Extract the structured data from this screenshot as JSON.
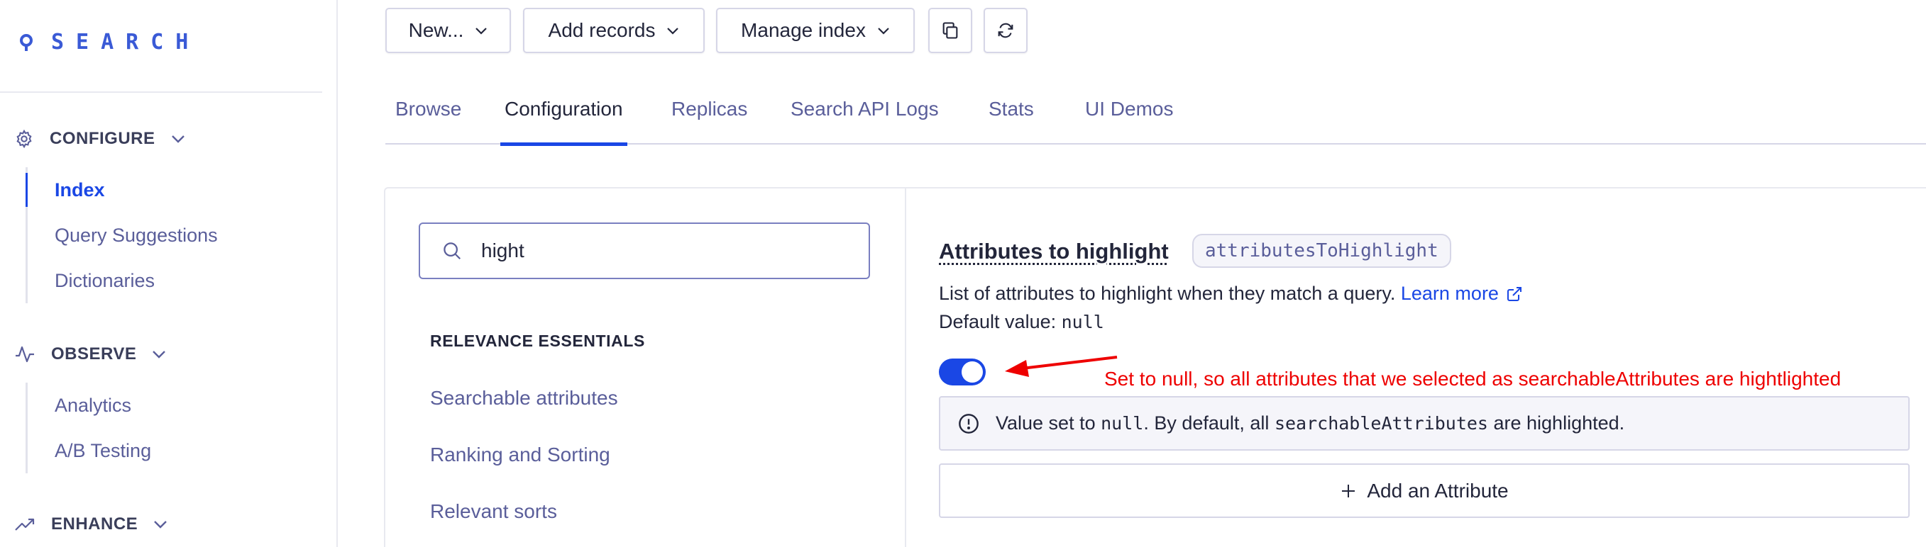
{
  "app": {
    "logo_text": "SEARCH"
  },
  "sidebar": {
    "sections": [
      {
        "label": "CONFIGURE",
        "icon": "gear-icon",
        "items": [
          {
            "label": "Index",
            "active": true
          },
          {
            "label": "Query Suggestions",
            "active": false
          },
          {
            "label": "Dictionaries",
            "active": false
          }
        ]
      },
      {
        "label": "OBSERVE",
        "icon": "activity-icon",
        "items": [
          {
            "label": "Analytics",
            "active": false
          },
          {
            "label": "A/B Testing",
            "active": false
          }
        ]
      },
      {
        "label": "ENHANCE",
        "icon": "trending-icon",
        "items": []
      }
    ]
  },
  "toolbar": {
    "new_label": "New...",
    "add_records_label": "Add records",
    "manage_index_label": "Manage index"
  },
  "tabs": [
    {
      "label": "Browse",
      "active": false
    },
    {
      "label": "Configuration",
      "active": true
    },
    {
      "label": "Replicas",
      "active": false
    },
    {
      "label": "Search API Logs",
      "active": false
    },
    {
      "label": "Stats",
      "active": false
    },
    {
      "label": "UI Demos",
      "active": false
    }
  ],
  "settings_search": {
    "value": "hight"
  },
  "relevance": {
    "title": "RELEVANCE ESSENTIALS",
    "items": [
      "Searchable attributes",
      "Ranking and Sorting",
      "Relevant sorts"
    ]
  },
  "attribute": {
    "title": "Attributes to highlight",
    "code": "attributesToHighlight",
    "description": "List of attributes to highlight when they match a query.",
    "learn_more": "Learn more",
    "default_label": "Default value:",
    "default_value": "null",
    "toggle_on": true,
    "info_prefix": "Value set to",
    "info_null": "null",
    "info_mid": ". By default, all",
    "info_code": "searchableAttributes",
    "info_suffix": "are highlighted.",
    "add_button": "Add an Attribute"
  },
  "annotation": {
    "text": "Set to null, so all attributes that we selected as searchableAttributes are hightlighted",
    "color": "#ee0000"
  },
  "colors": {
    "accent": "#1a47e5",
    "muted_text": "#5a5e9a",
    "border": "#d6d6e7"
  }
}
